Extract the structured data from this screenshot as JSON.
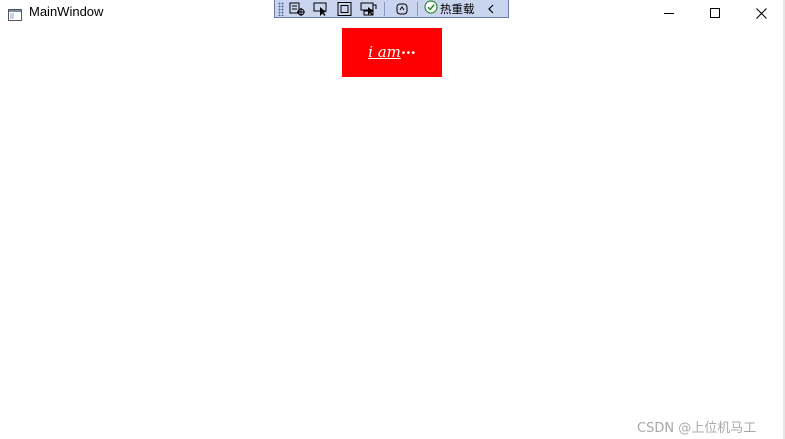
{
  "window": {
    "title": "MainWindow",
    "icon": "window-app-icon",
    "controls": {
      "minimize": "minimize-icon",
      "maximize": "maximize-icon",
      "close": "close-icon"
    }
  },
  "debug_toolbar": {
    "buttons": [
      {
        "icon": "visual-tree-icon"
      },
      {
        "icon": "select-element-icon"
      },
      {
        "icon": "display-layout-adorners-icon"
      },
      {
        "icon": "track-focus-icon"
      },
      {
        "icon": "binding-failures-icon"
      }
    ],
    "hot_reload_label": "热重载",
    "hot_reload_status": "ok",
    "collapse_icon": "chevron-left-icon"
  },
  "content": {
    "text": "i am",
    "ellipsis": "…",
    "background_color": "#ff0000",
    "text_color": "#ffffff"
  },
  "watermark": "CSDN @上位机马工"
}
